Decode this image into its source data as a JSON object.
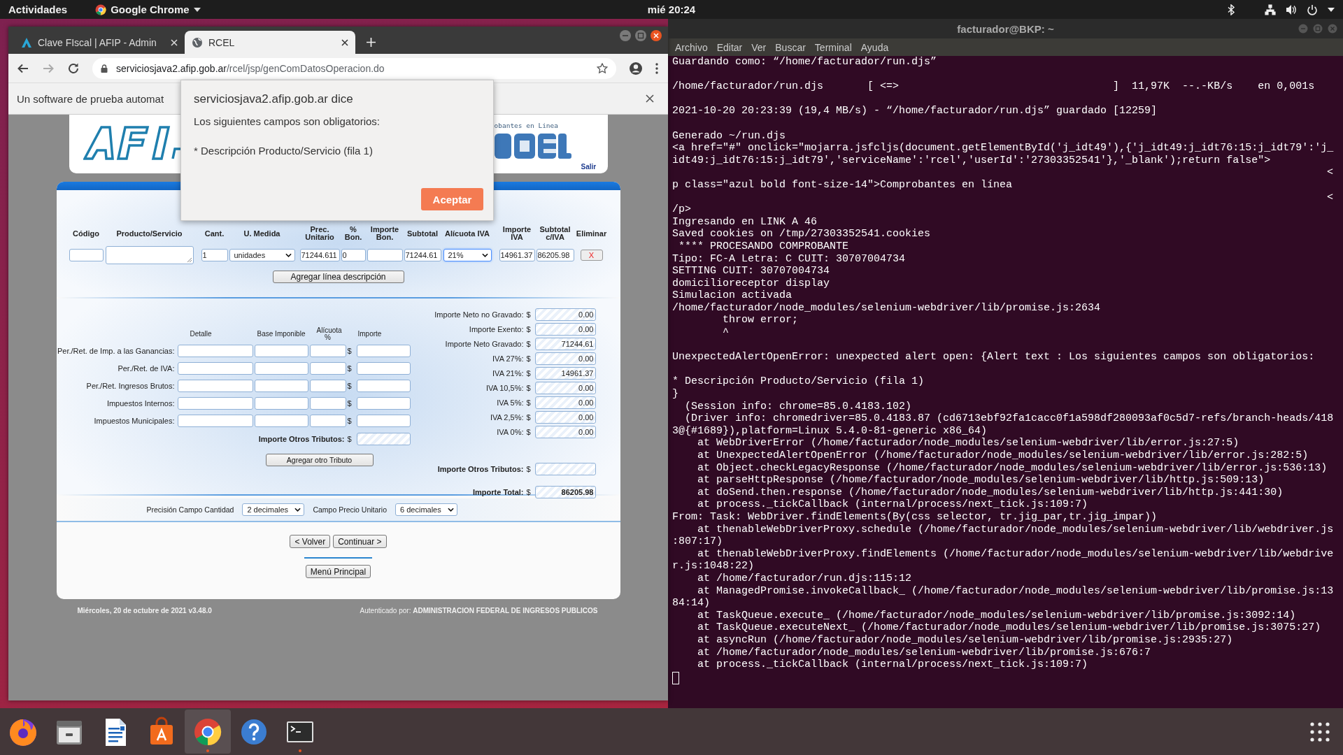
{
  "top_bar": {
    "activities": "Actividades",
    "app_menu": "Google Chrome",
    "clock": "mié 20:24"
  },
  "browser": {
    "tabs": [
      {
        "title": "Clave FIscal | AFIP - Admin",
        "selected": false
      },
      {
        "title": "RCEL",
        "selected": true
      }
    ],
    "url": {
      "host": "serviciosjava2.afip.gob.ar",
      "path": "/rcel/jsp/genComDatosOperacion.do"
    },
    "infobar": "Un software de prueba automat",
    "header": {
      "subtitle": "obantes en Linea",
      "logout": "Salir"
    },
    "product_table": {
      "columns": [
        "Código",
        "Producto/Servicio",
        "Cant.",
        "U. Medida",
        "Prec. Unitario",
        "% Bon.",
        "Importe Bon.",
        "Subtotal",
        "Alícuota IVA",
        "Importe IVA",
        "Subtotal c/IVA",
        "Eliminar"
      ],
      "rows": [
        {
          "quantity": "1",
          "unit": "unidades",
          "unit_price": "71244.611",
          "discount_pct": "0",
          "subtotal": "71244.61",
          "vat_rate": "21%",
          "vat_amount": "14961.37",
          "subtotal_with_vat": "86205.98",
          "delete": "X"
        }
      ]
    },
    "add_line_button": "Agregar línea descripción",
    "taxes": {
      "columns": [
        "Detalle",
        "Base Imponible",
        "Alícuota %",
        "Importe"
      ],
      "rows": [
        {
          "label": "Per./Ret. de Imp. a las Ganancias:",
          "currency": "$"
        },
        {
          "label": "Per./Ret. de IVA:",
          "currency": "$"
        },
        {
          "label": "Per./Ret. Ingresos Brutos:",
          "currency": "$"
        },
        {
          "label": "Impuestos Internos:",
          "currency": "$"
        },
        {
          "label": "Impuestos Municipales:",
          "currency": "$"
        }
      ],
      "total_label": "Importe Otros Tributos:",
      "total_currency": "$",
      "add_button": "Agregar otro Tributo"
    },
    "totals": [
      {
        "label": "Importe Neto no Gravado:",
        "currency": "$",
        "value": "0.00",
        "bold": false
      },
      {
        "label": "Importe Exento:",
        "currency": "$",
        "value": "0.00",
        "bold": false
      },
      {
        "label": "Importe Neto Gravado:",
        "currency": "$",
        "value": "71244.61",
        "bold": false
      },
      {
        "label": "IVA 27%:",
        "currency": "$",
        "value": "0.00",
        "bold": false
      },
      {
        "label": "IVA 21%:",
        "currency": "$",
        "value": "14961.37",
        "bold": false
      },
      {
        "label": "IVA 10,5%:",
        "currency": "$",
        "value": "0.00",
        "bold": false
      },
      {
        "label": "IVA 5%:",
        "currency": "$",
        "value": "0.00",
        "bold": false
      },
      {
        "label": "IVA 2,5%:",
        "currency": "$",
        "value": "0.00",
        "bold": false
      },
      {
        "label": "IVA 0%:",
        "currency": "$",
        "value": "0.00",
        "bold": false
      },
      {
        "label": "Importe Otros Tributos:",
        "currency": "$",
        "bold": true
      },
      {
        "label": "Importe Total:",
        "currency": "$",
        "value": "86205.98",
        "bold": true
      }
    ],
    "precision": {
      "quantity_label": "Precisión Campo Cantidad",
      "quantity_value": "2 decimales",
      "price_label": "Campo Precio Unitario",
      "price_value": "6 decimales"
    },
    "nav_buttons": [
      "< Volver",
      "Continuar >"
    ],
    "main_menu_button": "Menú Principal",
    "footer": {
      "date": "Miércoles, 20 de octubre de 2021 v3.48.0",
      "auth": "Autenticado por: **ADMINISTRACION FEDERAL DE INGRESOS PUBLICOS**"
    },
    "alert": {
      "title": "serviciosjava2.afip.gob.ar dice",
      "message": "Los siguientes campos son obligatorios:",
      "detail": "* Descripción Producto/Servicio (fila 1)",
      "button": "Aceptar"
    }
  },
  "terminal": {
    "title": "facturador@BKP: ~",
    "menu": [
      "Archivo",
      "Editar",
      "Ver",
      "Buscar",
      "Terminal",
      "Ayuda"
    ],
    "paragraphs": [
      [
        "Guardando como: “/home/facturador/run.djs”"
      ],
      [
        "/home/facturador/run.djs       [ <=>                                  ]  11,97K  --.-KB/s    en 0,001s"
      ],
      [
        "2021-10-20 20:23:39 (19,4 MB/s) - “/home/facturador/run.djs” guardado [12259]"
      ],
      [
        "Generado ~/run.djs",
        "<a href=\"#\" onclick=\"mojarra.jsfcljs(document.getElementById('j_idt49'),{'j_idt49:j_idt76:15:j_idt79':'j_",
        "idt49:j_idt76:15:j_idt79','serviceName':'rcel','userId':'27303352541'},'_blank');return false\">",
        {
          "text": "<",
          "kind": "right_edge"
        },
        "p class=\"azul bold font-size-14\">Comprobantes en línea",
        {
          "text": "<",
          "kind": "right_edge"
        },
        "/p>",
        "Ingresando en LINK A 46",
        "Saved cookies on /tmp/27303352541.cookies",
        " **** PROCESANDO COMPROBANTE",
        "Tipo: FC-A Letra: C CUIT: 30707004734",
        "SETTING CUIT: 30707004734",
        "domicilioreceptor display",
        "Simulacion activada",
        "/home/facturador/node_modules/selenium-webdriver/lib/promise.js:2634",
        "        throw error;",
        "        ^"
      ],
      [
        "UnexpectedAlertOpenError: unexpected alert open: {Alert text : Los siguientes campos son obligatorios:"
      ],
      [
        "* Descripción Producto/Servicio (fila 1)",
        "}",
        "  (Session info: chrome=85.0.4183.102)",
        "  (Driver info: chromedriver=85.0.4183.87 (cd6713ebf92fa1cacc0f1a598df280093af0c5d7-refs/branch-heads/418",
        "3@{#1689}),platform=Linux 5.4.0-81-generic x86_64)",
        "    at WebDriverError (/home/facturador/node_modules/selenium-webdriver/lib/error.js:27:5)",
        "    at UnexpectedAlertOpenError (/home/facturador/node_modules/selenium-webdriver/lib/error.js:282:5)",
        "    at Object.checkLegacyResponse (/home/facturador/node_modules/selenium-webdriver/lib/error.js:536:13)",
        "    at parseHttpResponse (/home/facturador/node_modules/selenium-webdriver/lib/http.js:509:13)",
        "    at doSend.then.response (/home/facturador/node_modules/selenium-webdriver/lib/http.js:441:30)",
        "    at process._tickCallback (internal/process/next_tick.js:109:7)",
        "From: Task: WebDriver.findElements(By(css selector, tr.jig_par,tr.jig_impar))",
        "    at thenableWebDriverProxy.schedule (/home/facturador/node_modules/selenium-webdriver/lib/webdriver.js",
        ":807:17)",
        "    at thenableWebDriverProxy.findElements (/home/facturador/node_modules/selenium-webdriver/lib/webdrive",
        "r.js:1048:22)",
        "    at /home/facturador/run.djs:115:12",
        "    at ManagedPromise.invokeCallback_ (/home/facturador/node_modules/selenium-webdriver/lib/promise.js:13",
        "84:14)",
        "    at TaskQueue.execute_ (/home/facturador/node_modules/selenium-webdriver/lib/promise.js:3092:14)",
        "    at TaskQueue.executeNext_ (/home/facturador/node_modules/selenium-webdriver/lib/promise.js:3075:27)",
        "    at asyncRun (/home/facturador/node_modules/selenium-webdriver/lib/promise.js:2935:27)",
        "    at /home/facturador/node_modules/selenium-webdriver/lib/promise.js:676:7",
        "    at process._tickCallback (internal/process/next_tick.js:109:7)"
      ]
    ]
  }
}
